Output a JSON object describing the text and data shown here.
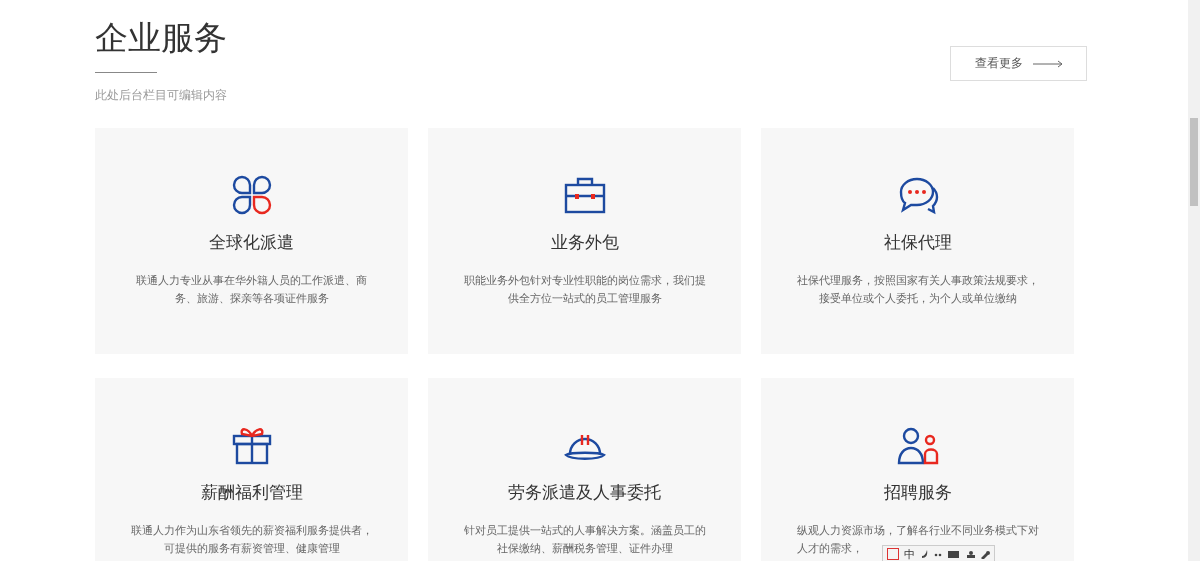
{
  "header": {
    "title": "企业服务",
    "subtitle": "此处后台栏目可编辑内容",
    "more_button": "查看更多"
  },
  "services": [
    {
      "kind": "clover",
      "title": "全球化派遣",
      "description_lines": [
        "联通人力专业从事在华外籍人员的工作派遣、商",
        "务、旅游、探亲等各项证件服务"
      ]
    },
    {
      "kind": "briefcase",
      "title": "业务外包",
      "description_lines": [
        "职能业务外包针对专业性职能的岗位需求，我们提",
        "供全方位一站式的员工管理服务"
      ]
    },
    {
      "kind": "chat",
      "title": "社保代理",
      "description_lines": [
        "社保代理服务，按照国家有关人事政策法规要求，",
        "接受单位或个人委托，为个人或单位缴纳"
      ]
    },
    {
      "kind": "gift",
      "title": "薪酬福利管理",
      "description_lines": [
        "联通人力作为山东省领先的薪资福利服务提供者，",
        "可提供的服务有薪资管理、健康管理"
      ]
    },
    {
      "kind": "helmet",
      "title": "劳务派遣及人事委托",
      "description_lines": [
        "针对员工提供一站式的人事解决方案。涵盖员工的",
        "社保缴纳、薪酬税务管理、证件办理"
      ]
    },
    {
      "kind": "people",
      "title": "招聘服务",
      "description_lines": [
        "纵观人力资源市场，了解各行业不同业务模式下对",
        "人才的需求，"
      ]
    }
  ],
  "ime_toolbar": {
    "mode": "中"
  }
}
